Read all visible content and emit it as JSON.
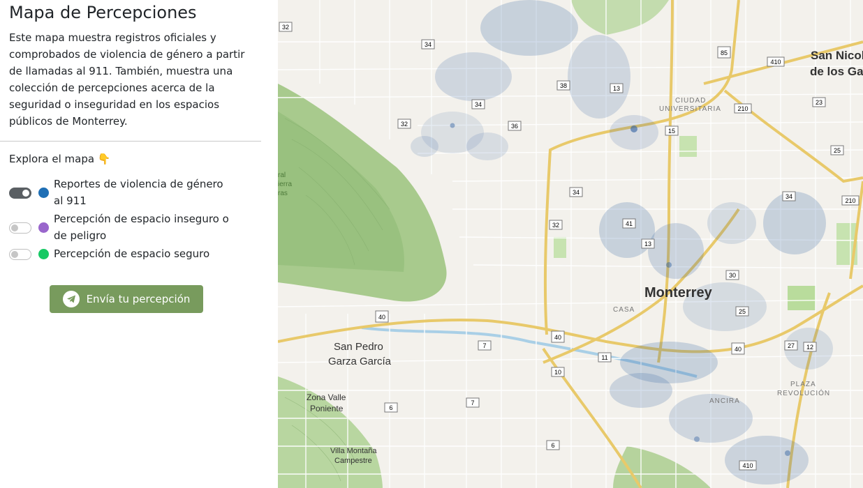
{
  "sidebar": {
    "title": "Mapa de Percepciones",
    "intro": "Este mapa muestra registros oficiales y comprobados de violencia de género a partir de llamadas al 911. También, muestra una colección de percepciones acerca de la seguridad o inseguridad en los espacios públicos de Monterrey.",
    "explore_label": "Explora el mapa 👇",
    "layers": [
      {
        "label": "Reportes de violencia de género al 911",
        "color": "#1f6fb5",
        "enabled": true
      },
      {
        "label": "Percepción de espacio inseguro o de peligro",
        "color": "#9966cc",
        "enabled": false
      },
      {
        "label": "Percepción de espacio seguro",
        "color": "#17c964",
        "enabled": false
      }
    ],
    "send_button": "Envía tu percepción"
  },
  "map": {
    "place_labels": {
      "monterrey": "Monterrey",
      "san_pedro_1": "San Pedro",
      "san_pedro_2": "Garza García",
      "san_nicolas_1": "San Nicol",
      "san_nicolas_2": "de los Gar",
      "ciudad_1": "CIUDAD",
      "ciudad_2": "UNIVERSITARIA",
      "casa": "CASA",
      "anzures": "ANCIRA",
      "plaza_1": "PLAZA",
      "plaza_2": "REVOLUCIÓN",
      "zona_valle_1": "Zona Valle",
      "zona_valle_2": "Poniente",
      "villa_1": "Villa Montaña",
      "villa_2": "Campestre",
      "sierra_1": "ral",
      "sierra_2": "ierra",
      "sierra_3": "ras"
    },
    "road_shields": [
      "32",
      "34",
      "38",
      "13",
      "85",
      "410",
      "210",
      "23",
      "25",
      "34",
      "36",
      "15",
      "32",
      "34",
      "32",
      "41",
      "13",
      "30",
      "25",
      "34",
      "210",
      "40",
      "7",
      "40",
      "11",
      "10",
      "40",
      "27",
      "12",
      "7",
      "6",
      "6",
      "410"
    ],
    "colors": {
      "hotspot": "#2f5fa0",
      "highway": "#e8c96a",
      "park": "#b9dc9c",
      "terrain": "#9fc486",
      "button": "#789b5d"
    }
  }
}
